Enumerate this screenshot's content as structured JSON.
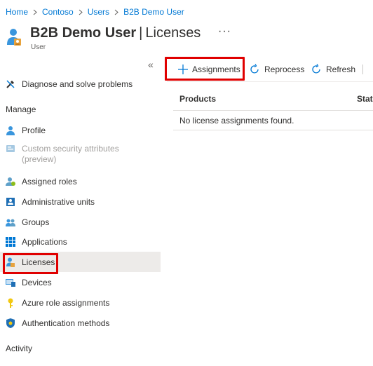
{
  "breadcrumb": [
    "Home",
    "Contoso",
    "Users",
    "B2B Demo User"
  ],
  "header": {
    "title_name": "B2B Demo User",
    "title_separator": "|",
    "title_page": "Licenses",
    "subtitle": "User",
    "more_label": "···"
  },
  "nav": {
    "collapse_label": "«",
    "diagnose": "Diagnose and solve problems",
    "manage_heading": "Manage",
    "items": [
      {
        "label": "Profile",
        "icon": "profile-icon"
      },
      {
        "label": "Custom security attributes (preview)",
        "icon": "custom-security-icon",
        "disabled": true
      },
      {
        "label": "Assigned roles",
        "icon": "assigned-roles-icon"
      },
      {
        "label": "Administrative units",
        "icon": "admin-units-icon"
      },
      {
        "label": "Groups",
        "icon": "groups-icon"
      },
      {
        "label": "Applications",
        "icon": "applications-icon"
      },
      {
        "label": "Licenses",
        "icon": "licenses-icon",
        "selected": true
      },
      {
        "label": "Devices",
        "icon": "devices-icon"
      },
      {
        "label": "Azure role assignments",
        "icon": "key-icon"
      },
      {
        "label": "Authentication methods",
        "icon": "shield-icon"
      }
    ],
    "activity_heading": "Activity"
  },
  "toolbar": {
    "assignments": "Assignments",
    "reprocess": "Reprocess",
    "refresh": "Refresh"
  },
  "table": {
    "columns": [
      "Products",
      "State"
    ],
    "empty_message": "No license assignments found."
  },
  "colors": {
    "link": "#0078d4",
    "highlight": "#e00000",
    "selected_bg": "#edebe9"
  }
}
